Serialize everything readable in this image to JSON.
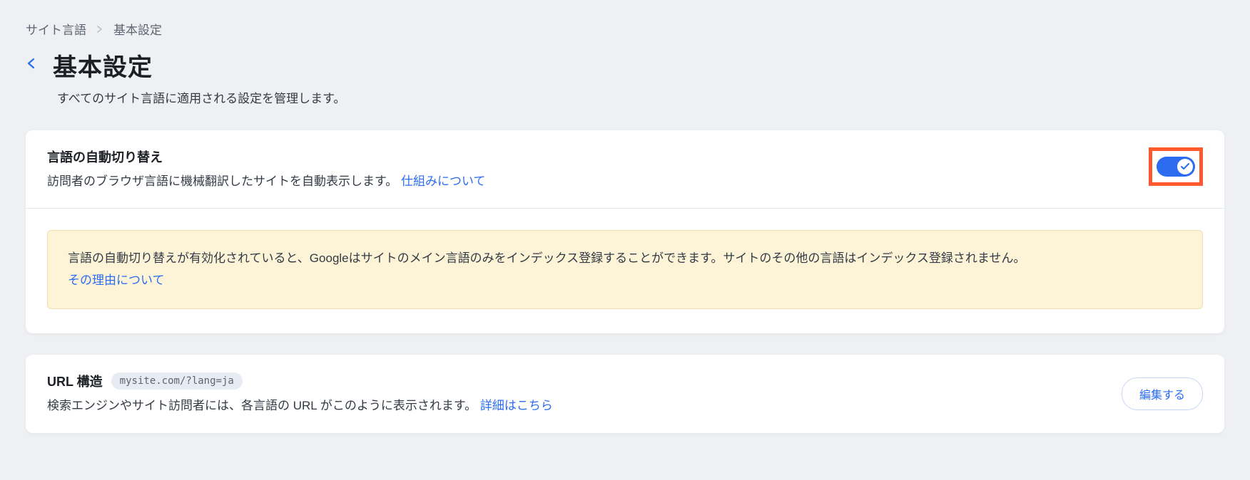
{
  "breadcrumb": {
    "parent": "サイト言語",
    "current": "基本設定"
  },
  "header": {
    "title": "基本設定",
    "subtitle": "すべてのサイト言語に適用される設定を管理します。"
  },
  "auto_switch": {
    "title": "言語の自動切り替え",
    "desc_prefix": "訪問者のブラウザ言語に機械翻訳したサイトを自動表示します。",
    "link": "仕組みについて",
    "toggle_on": true
  },
  "warning": {
    "text": "言語の自動切り替えが有効化されていると、Googleはサイトのメイン言語のみをインデックス登録することができます。サイトのその他の言語はインデックス登録されません。",
    "link": "その理由について"
  },
  "url_structure": {
    "title": "URL 構造",
    "example": "mysite.com/?lang=ja",
    "desc_prefix": "検索エンジンやサイト訪問者には、各言語の URL がこのように表示されます。",
    "link": "詳細はこちら",
    "edit_button": "編集する"
  }
}
